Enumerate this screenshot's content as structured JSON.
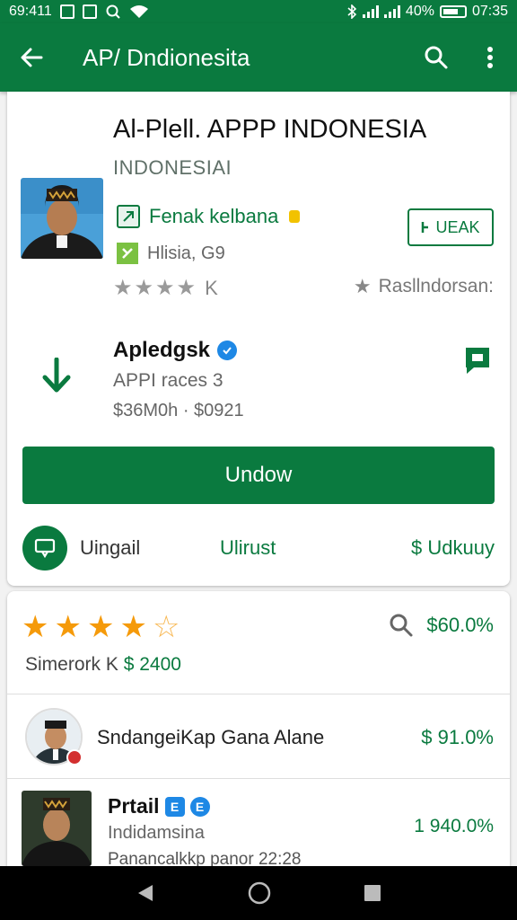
{
  "status_bar": {
    "time_left": "69:411",
    "battery": "40%",
    "time_right": "07:35"
  },
  "app_bar": {
    "title": "AP/ Dndionesita"
  },
  "app": {
    "title": "Al-Plell. APPP INDONESIA",
    "subtitle": "INDONESIAI",
    "developer": "Fenak kelbana",
    "action_small": "UEAK",
    "category": "Hlisia, G9",
    "stars_suffix": "K",
    "rating_label": "Rasllndorsan:",
    "info_title": "Apledgsk",
    "info_sub": "APPI races 3",
    "info_price": "$36M0h · $0921",
    "install_label": "Undow",
    "action1": "Uingail",
    "action2": "Ulirust",
    "action3": "$ Udkuuy"
  },
  "reviews": {
    "summary_price": "$60.0%",
    "summary_line_a": "Simerork",
    "summary_line_b": "$ 2400",
    "item1": {
      "text": "SndangeiKap Gana Alane",
      "price": "$ 91.0%"
    },
    "item2": {
      "title": "Prtail",
      "badge1": "E",
      "badge2": "E",
      "sub": "Indidamsina",
      "line": "Panancalkkp panor 22:28",
      "price": "1 940.0%"
    }
  },
  "colors": {
    "primary": "#0a7a3f",
    "star": "#f59a0a",
    "verify": "#1e88e5"
  }
}
